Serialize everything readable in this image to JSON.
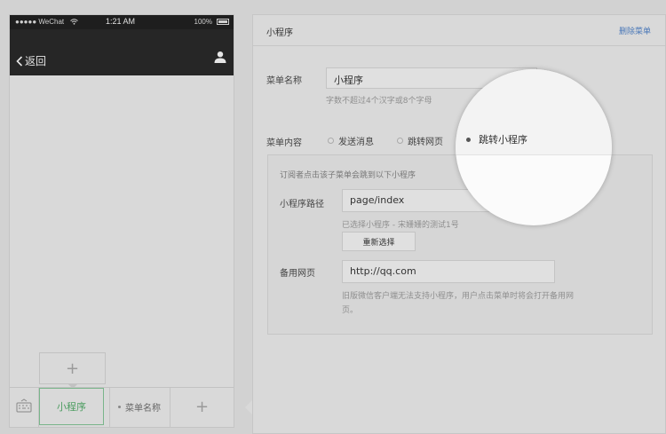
{
  "phone": {
    "status": {
      "carrier": "●●●●● WeChat",
      "time": "1:21 AM",
      "battery": "100%"
    },
    "nav": {
      "back_label": "返回"
    },
    "menu": {
      "active_label": "小程序",
      "second_label": "菜单名称",
      "add_symbol": "+",
      "submenu_add_symbol": "+"
    }
  },
  "editor": {
    "title": "小程序",
    "delete_label": "删除菜单",
    "name_label": "菜单名称",
    "name_value": "小程序",
    "name_hint": "字数不超过4个汉字或8个字母",
    "content_label": "菜单内容",
    "options": [
      "发送消息",
      "跳转网页",
      "跳转小程序"
    ],
    "selected_option": "跳转小程序",
    "box": {
      "intro": "订阅者点击该子菜单会跳到以下小程序",
      "path_label": "小程序路径",
      "path_value": "page/index",
      "selected_hint": "已选择小程序 - 宋姗姗的测试1号",
      "reselect_label": "重新选择",
      "backup_label": "备用网页",
      "backup_value": "http://qq.com",
      "backup_hint_line1": "旧版微信客户端无法支持小程序，用户点击菜单时将会打开备用网",
      "backup_hint_line2": "页。"
    }
  },
  "colors": {
    "accent_green": "#4e9d62",
    "link_blue": "#4a78b8",
    "nav_dark": "#262626"
  },
  "icons": [
    "wifi-icon",
    "battery-icon",
    "back-chevron-icon",
    "user-icon",
    "keyboard-icon",
    "radio-selected-icon"
  ]
}
